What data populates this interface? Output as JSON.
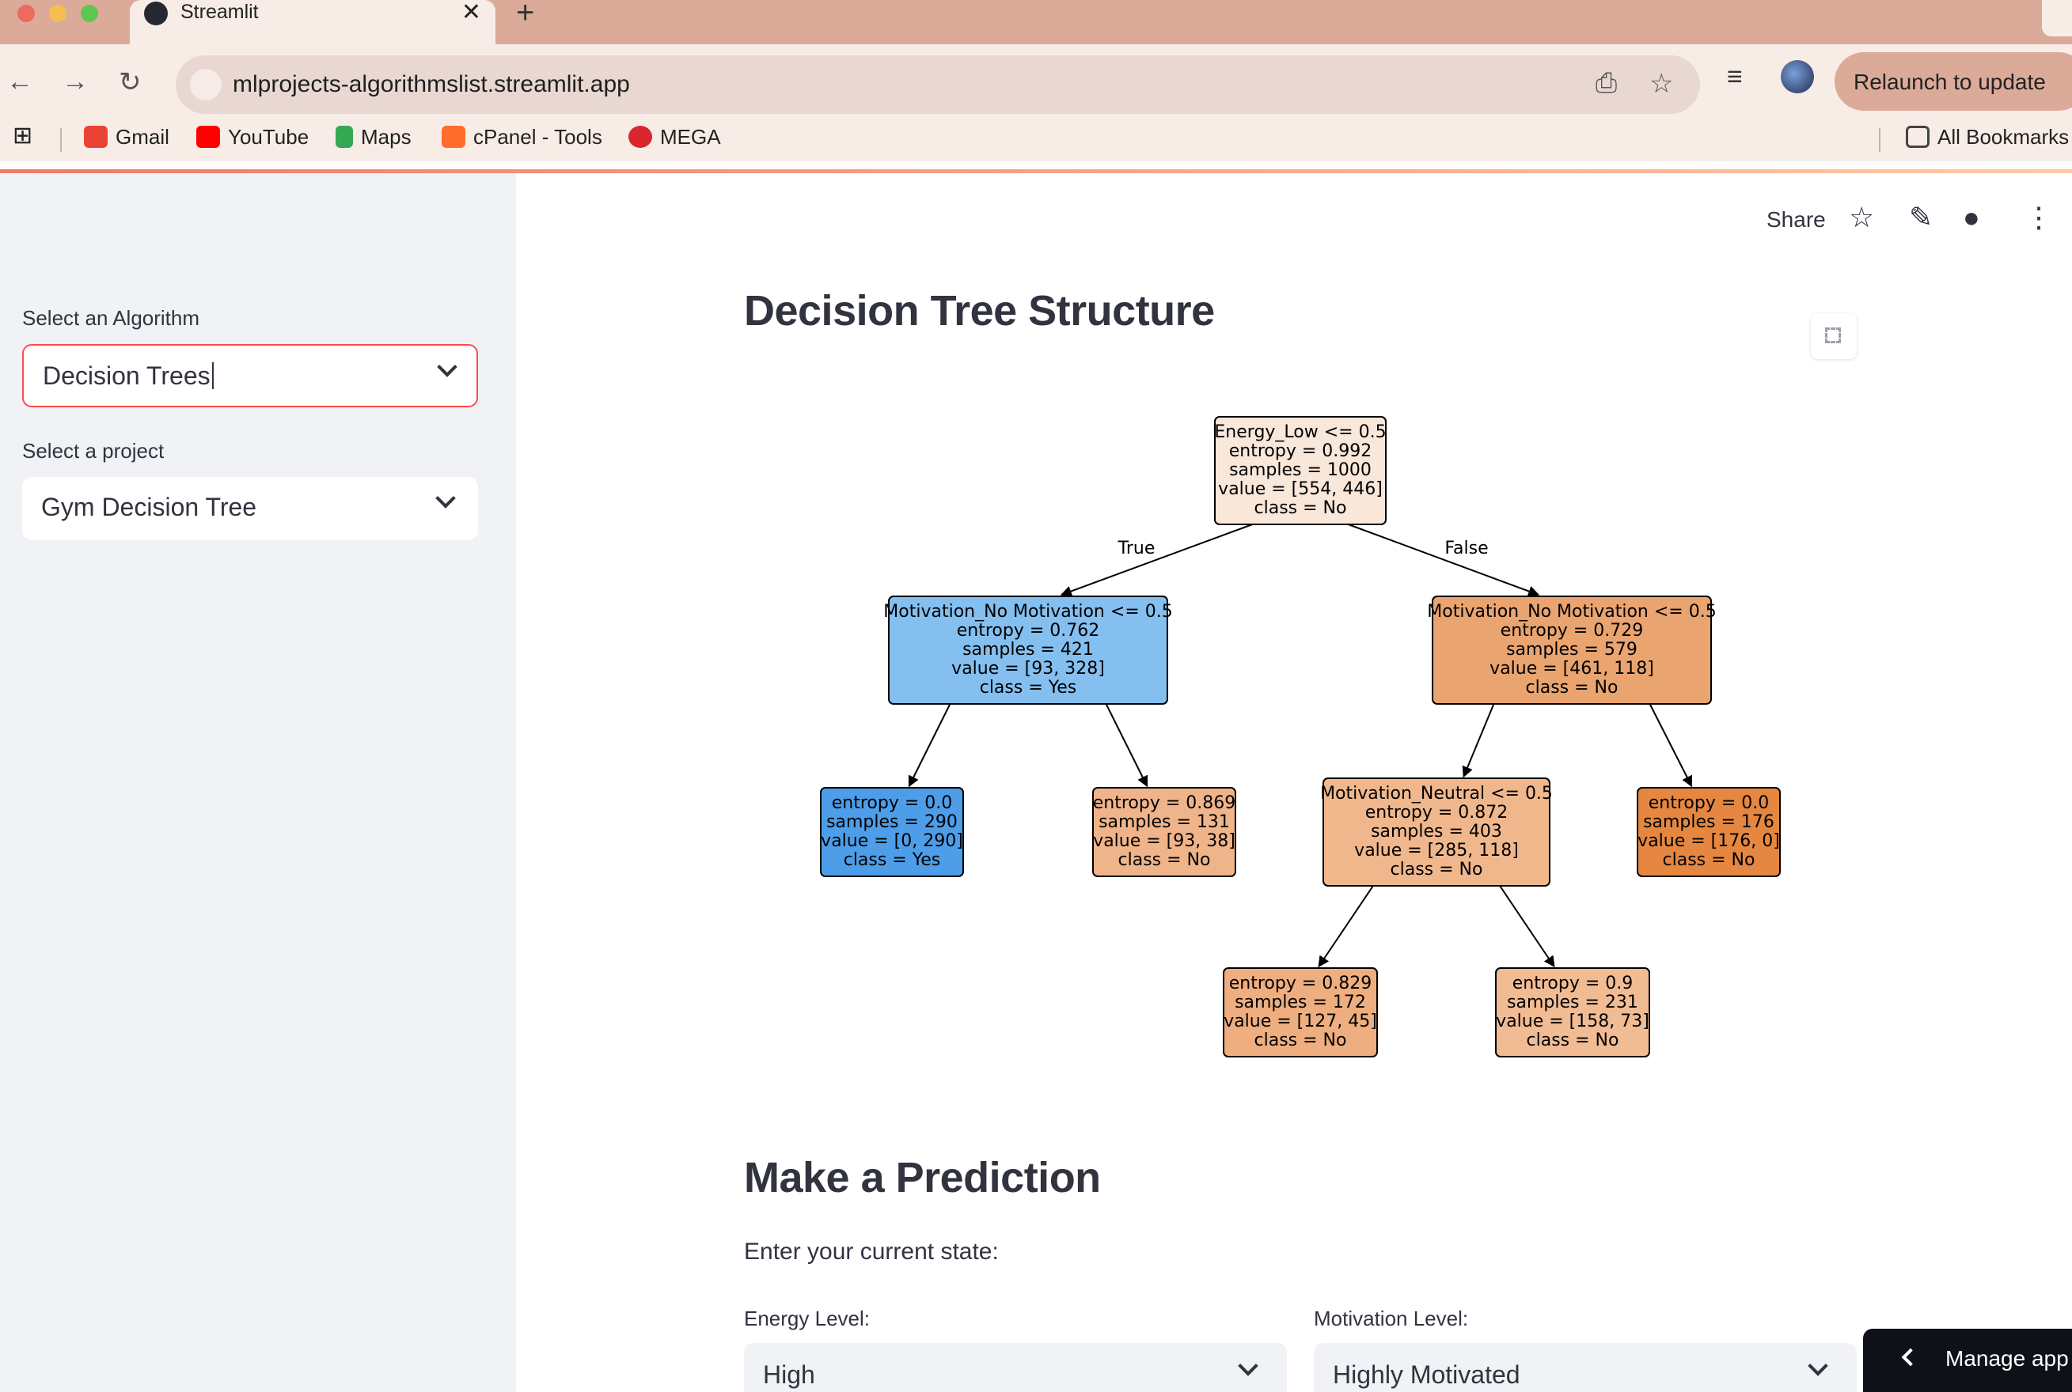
{
  "browser": {
    "tab_title": "Streamlit",
    "tab_close": "✕",
    "new_tab": "+",
    "url": "mlprojects-algorithmslist.streamlit.app",
    "relaunch_label": "Relaunch to update",
    "bookmarks": [
      "Gmail",
      "YouTube",
      "Maps",
      "cPanel - Tools",
      "MEGA"
    ],
    "all_bookmarks": "All Bookmarks",
    "colors": {
      "tabbar": "#dcaa99",
      "toolbar": "#f8ece7"
    }
  },
  "sidebar": {
    "algorithm_label": "Select an Algorithm",
    "algorithm_value": "Decision Trees",
    "project_label": "Select a project",
    "project_value": "Gym Decision Tree"
  },
  "header": {
    "share_label": "Share"
  },
  "main": {
    "tree_heading": "Decision Tree Structure",
    "predict_heading": "Make a Prediction",
    "prompt": "Enter your current state:",
    "energy_label": "Energy Level:",
    "energy_value": "High",
    "motivation_label": "Motivation Level:",
    "motivation_value": "Highly Motivated"
  },
  "manage_app_label": "Manage app",
  "tree": {
    "edge_labels": [
      "True",
      "False"
    ],
    "nodes": [
      {
        "id": "root",
        "lines": [
          "Energy_Low <= 0.5",
          "entropy = 0.992",
          "samples = 1000",
          "value = [554, 446]",
          "class = No"
        ],
        "fill": "#f9e7da"
      },
      {
        "id": "left",
        "lines": [
          "Motivation_No Motivation <= 0.5",
          "entropy = 0.762",
          "samples = 421",
          "value = [93, 328]",
          "class = Yes"
        ],
        "fill": "#84bfef"
      },
      {
        "id": "right",
        "lines": [
          "Motivation_No Motivation <= 0.5",
          "entropy = 0.729",
          "samples = 579",
          "value = [461, 118]",
          "class = No"
        ],
        "fill": "#e9a470"
      },
      {
        "id": "ll",
        "lines": [
          "entropy = 0.0",
          "samples = 290",
          "value = [0, 290]",
          "class = Yes"
        ],
        "fill": "#4d9de8"
      },
      {
        "id": "lr",
        "lines": [
          "entropy = 0.869",
          "samples = 131",
          "value = [93, 38]",
          "class = No"
        ],
        "fill": "#efb48a"
      },
      {
        "id": "rl",
        "lines": [
          "Motivation_Neutral <= 0.5",
          "entropy = 0.872",
          "samples = 403",
          "value = [285, 118]",
          "class = No"
        ],
        "fill": "#f0b78d"
      },
      {
        "id": "rr",
        "lines": [
          "entropy = 0.0",
          "samples = 176",
          "value = [176, 0]",
          "class = No"
        ],
        "fill": "#e68741"
      },
      {
        "id": "rll",
        "lines": [
          "entropy = 0.829",
          "samples = 172",
          "value = [127, 45]",
          "class = No"
        ],
        "fill": "#eeae7f"
      },
      {
        "id": "rlr",
        "lines": [
          "entropy = 0.9",
          "samples = 231",
          "value = [158, 73]",
          "class = No"
        ],
        "fill": "#f1bb94"
      }
    ]
  }
}
